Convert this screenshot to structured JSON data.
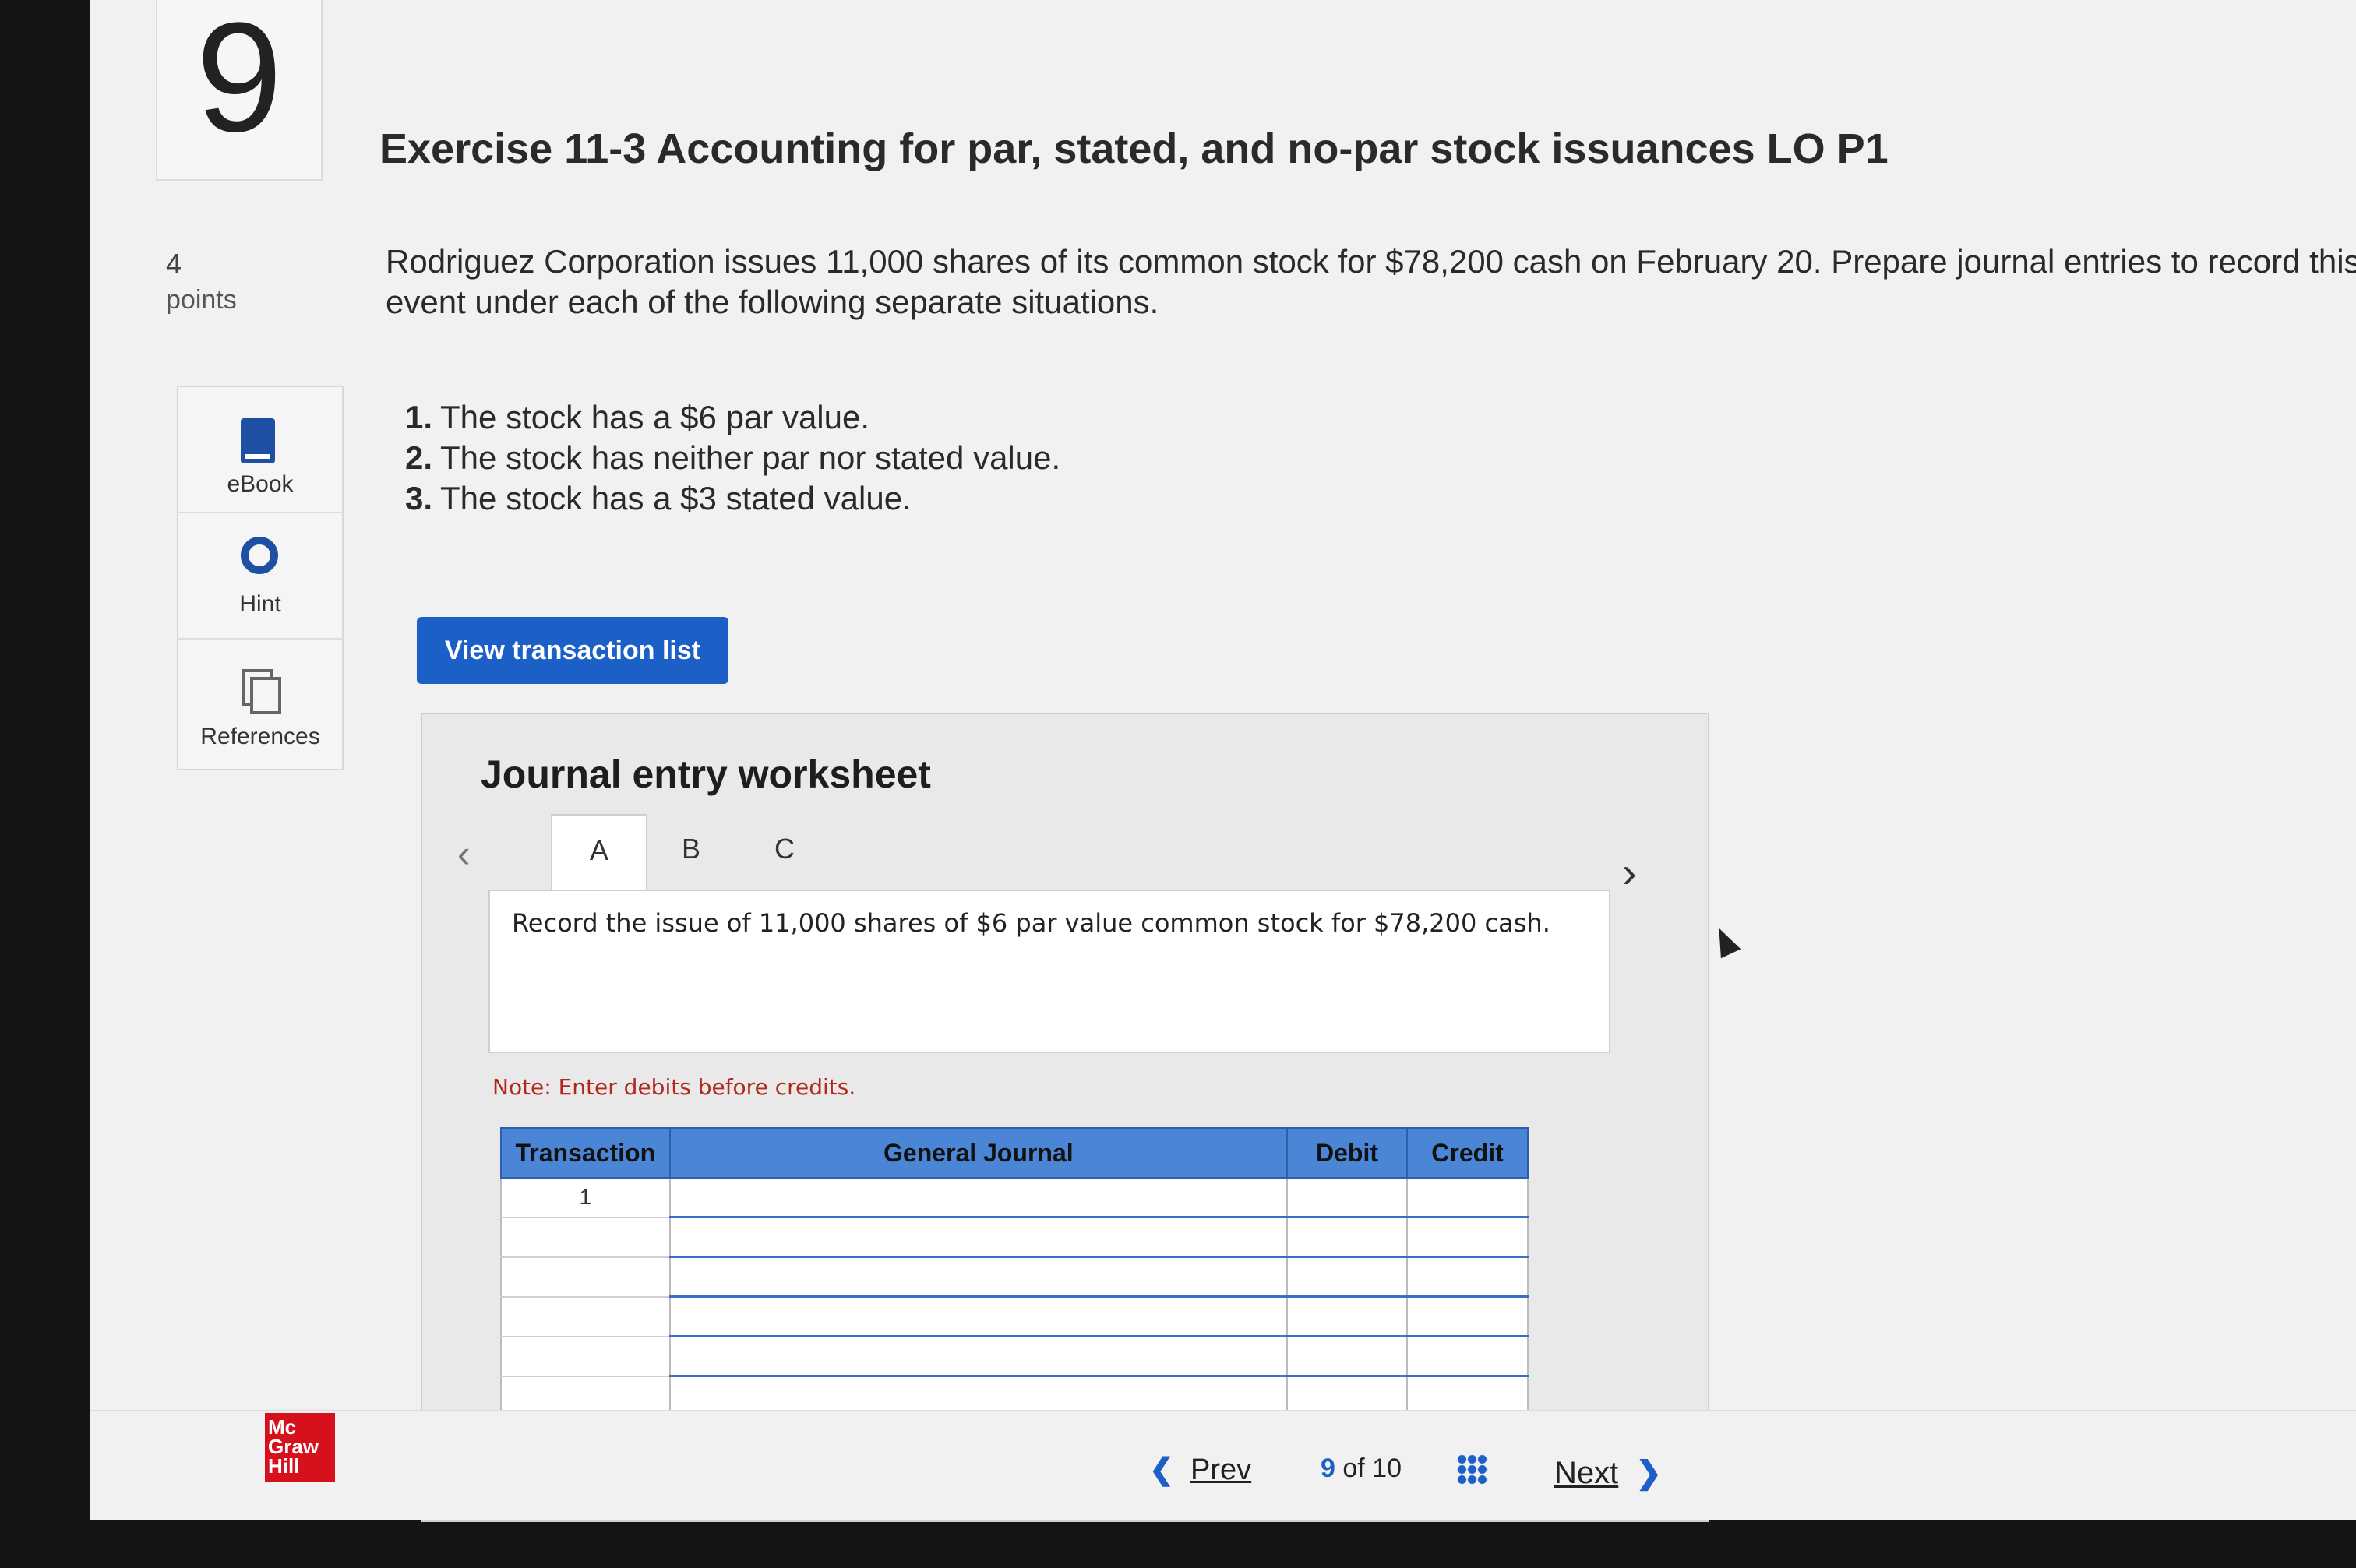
{
  "question": {
    "number": "9",
    "points_value": "4",
    "points_label": "points",
    "title": "Exercise 11-3 Accounting for par, stated, and no-par stock issuances LO P1",
    "prompt": "Rodriguez Corporation issues 11,000 shares of its common stock for $78,200 cash on February 20. Prepare journal entries to record this event under each of the following separate situations.",
    "requirements": [
      {
        "num": "1.",
        "text": "The stock has a $6 par value."
      },
      {
        "num": "2.",
        "text": "The stock has neither par nor stated value."
      },
      {
        "num": "3.",
        "text": "The stock has a $3 stated value."
      }
    ]
  },
  "sidebar": {
    "items": [
      {
        "label": "eBook",
        "icon": "book-icon"
      },
      {
        "label": "Hint",
        "icon": "lifebuoy-icon"
      },
      {
        "label": "References",
        "icon": "copy-icon"
      }
    ]
  },
  "actions": {
    "view_transactions": "View transaction list"
  },
  "worksheet": {
    "title": "Journal entry worksheet",
    "tabs": [
      "A",
      "B",
      "C"
    ],
    "active_tab": "A",
    "description": "Record the issue of 11,000 shares of $6 par value common stock for $78,200 cash.",
    "note": "Note: Enter debits before credits.",
    "table": {
      "headers": [
        "Transaction",
        "General Journal",
        "Debit",
        "Credit"
      ],
      "rows": [
        {
          "transaction": "1",
          "account": "",
          "debit": "",
          "credit": ""
        },
        {
          "transaction": "",
          "account": "",
          "debit": "",
          "credit": ""
        },
        {
          "transaction": "",
          "account": "",
          "debit": "",
          "credit": ""
        },
        {
          "transaction": "",
          "account": "",
          "debit": "",
          "credit": ""
        },
        {
          "transaction": "",
          "account": "",
          "debit": "",
          "credit": ""
        },
        {
          "transaction": "",
          "account": "",
          "debit": "",
          "credit": ""
        }
      ]
    }
  },
  "footer": {
    "logo_text": "Mc Graw Hill",
    "prev_label": "Prev",
    "current_page": "9",
    "of_label": "of",
    "total_pages": "10",
    "next_label": "Next"
  },
  "colors": {
    "accent": "#1b5fc7",
    "table_header": "#4b86d6",
    "note": "#b0281e",
    "logo": "#d6111c"
  }
}
